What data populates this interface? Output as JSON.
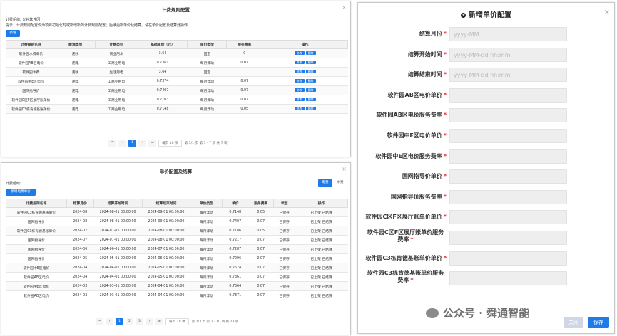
{
  "p1": {
    "title": "计费规则配置",
    "org": "计费组织: 光谷软件园",
    "tip": "提示：计费规则配置仅为项目初始化时或新增新的计费规则配置；后续更新单价及结算，请在单价配置及结算处操作",
    "add_label": "新增",
    "columns": [
      "计费规则名称",
      "能源类型",
      "计费类别",
      "基础单价（元）",
      "单价类型",
      "服务费率",
      "操作"
    ],
    "rows": [
      [
        "软件园水费单价",
        "用水",
        "商业用水",
        "3.64",
        "固定",
        "0"
      ],
      [
        "软件园AB区电价",
        "用电",
        "工商业用电",
        "0.7361",
        "每月浮动",
        "0.07"
      ],
      [
        "软件园水费",
        "用水",
        "生活用电",
        "3.64",
        "固定",
        ""
      ],
      [
        "软件园中E区电价",
        "用电",
        "工商业用电",
        "0.7374",
        "每月浮动",
        "0.07"
      ],
      [
        "国网指导价",
        "用电",
        "工商业用电",
        "0.7407",
        "每月浮动",
        "0.07"
      ],
      [
        "软件园C区F区展厅账单价",
        "用电",
        "工商业用电",
        "0.7103",
        "每月浮动",
        "0.07"
      ],
      [
        "软件园C3栋肯德基账单价",
        "用电",
        "工商业用电",
        "0.7148",
        "每月浮动",
        "0.05"
      ]
    ],
    "edit": "修改",
    "del": "删除",
    "pager": {
      "pages": [
        "1"
      ],
      "active": "1",
      "size": "每页 10 项",
      "info": "第 1/1 页  第 1 - 7 项  共 7 项"
    }
  },
  "p2": {
    "title": "单价配置及结算",
    "org": "计费组织:",
    "add_label": "新增电费单价",
    "tab_elec": "电费",
    "tab_water": "水费",
    "columns": [
      "计费规则名称",
      "结算月份",
      "结算开始时间",
      "结算结束时间",
      "单价类型",
      "单价",
      "服务费率",
      "状态",
      "操作"
    ],
    "rows": [
      [
        "软件园C3栋肯德基账单价",
        "2024-08",
        "2024-08-01 00:00:00",
        "2024-09-01 00:00:00",
        "每月浮动",
        "0.7148",
        "0.05",
        "已保存",
        "已上架 已结算"
      ],
      [
        "国网指导价",
        "2024-08",
        "2024-08-01 00:00:00",
        "2024-09-01 00:00:00",
        "每月浮动",
        "0.7407",
        "0.07",
        "已保存",
        "已上架 已结算"
      ],
      [
        "软件园C3栋肯德基账单价",
        "2024-07",
        "2024-07-01 00:00:00",
        "2024-08-01 00:00:00",
        "每月浮动",
        "0.7186",
        "0.05",
        "已保存",
        "已上架 已结算"
      ],
      [
        "国网指导价",
        "2024-07",
        "2024-07-01 00:00:00",
        "2024-08-01 00:00:00",
        "每月浮动",
        "0.7217",
        "0.07",
        "已保存",
        "已上架 已结算"
      ],
      [
        "国网指导价",
        "2024-06",
        "2024-06-01 00:00:00",
        "2024-07-01 00:00:00",
        "每月浮动",
        "0.7287",
        "0.07",
        "已保存",
        "已上架 已结算"
      ],
      [
        "国网指导价",
        "2024-05",
        "2024-05-01 00:00:00",
        "2024-06-01 00:00:00",
        "每月浮动",
        "0.7296",
        "0.07",
        "已保存",
        "已上架 已结算"
      ],
      [
        "软件园中E区电价",
        "2024-04",
        "2024-04-01 00:00:00",
        "2024-05-01 00:00:00",
        "每月浮动",
        "0.7574",
        "0.07",
        "已保存",
        "已上架 已结算"
      ],
      [
        "软件园AB区电价",
        "2024-04",
        "2024-04-01 00:00:00",
        "2024-05-01 00:00:00",
        "每月浮动",
        "0.7361",
        "0.07",
        "已保存",
        "已上架 已结算"
      ],
      [
        "软件园中E区电价",
        "2024-03",
        "2024-03-01 00:00:00",
        "2024-04-01 00:00:00",
        "每月浮动",
        "0.7364",
        "0.07",
        "已保存",
        "已上架 已结算"
      ],
      [
        "软件园AB区电价",
        "2024-03",
        "2024-03-01 00:00:00",
        "2024-04-01 00:00:00",
        "每月浮动",
        "0.7371",
        "0.07",
        "已保存",
        "已上架 已结算"
      ]
    ],
    "pager": {
      "pages": [
        "1",
        "2",
        "3"
      ],
      "active": "1",
      "size": "每页 10 项",
      "info": "第 1/3 页  第 1 - 10 项  共 23 项"
    }
  },
  "p3": {
    "title": "新增单价配置",
    "fields": [
      {
        "label": "结算月份",
        "placeholder": "yyyy-MM"
      },
      {
        "label": "结算开始时间",
        "placeholder": "yyyy-MM-dd hh:mm"
      },
      {
        "label": "结算结束时间",
        "placeholder": "yyyy-MM-dd hh:mm"
      },
      {
        "label": "软件园AB区电价单价",
        "placeholder": ""
      },
      {
        "label": "软件园AB区电价服务费率",
        "placeholder": ""
      },
      {
        "label": "软件园中E区电价单价",
        "placeholder": ""
      },
      {
        "label": "软件园中E区电价服务费率",
        "placeholder": ""
      },
      {
        "label": "国网指导价单价",
        "placeholder": ""
      },
      {
        "label": "国网指导价服务费率",
        "placeholder": ""
      },
      {
        "label": "软件园C区F区展厅账单价单价",
        "placeholder": ""
      },
      {
        "label": "软件园C区F区展厅账单价服务\n费率",
        "placeholder": ""
      },
      {
        "label": "软件园C3栋肯德基账单价单价",
        "placeholder": ""
      },
      {
        "label": "软件园C3栋肯德基账单价服务\n费率",
        "placeholder": ""
      }
    ],
    "close_label": "关闭",
    "save_label": "保存"
  },
  "watermark": "公众号 · 舜通智能",
  "colors": {
    "accent": "#1e7be8",
    "required": "#e23"
  }
}
